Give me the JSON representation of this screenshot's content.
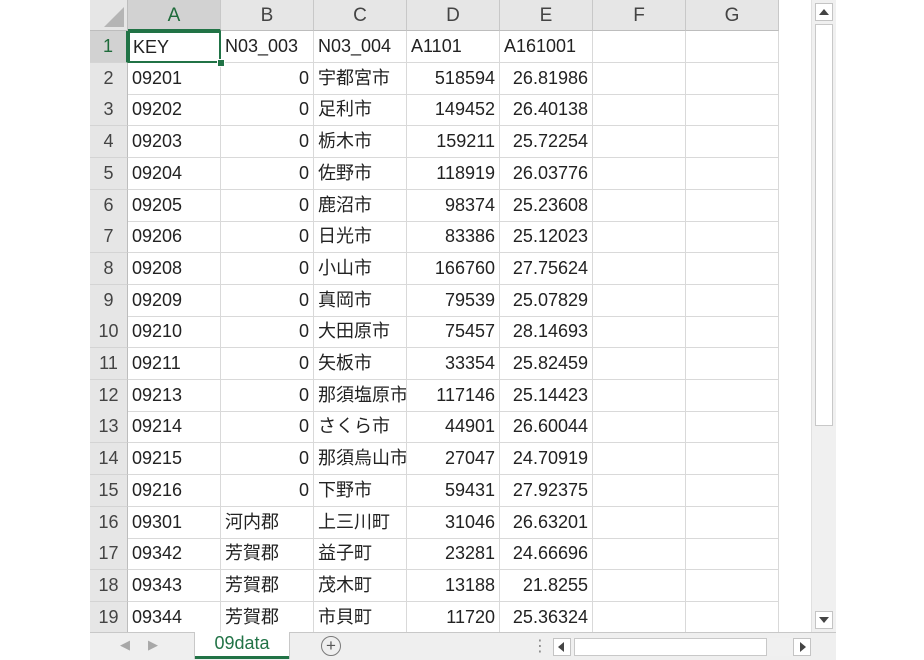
{
  "columns": [
    "A",
    "B",
    "C",
    "D",
    "E",
    "F",
    "G"
  ],
  "rows": [
    {
      "n": "1",
      "cells": [
        "KEY",
        "N03_003",
        "N03_004",
        "A1101",
        "A161001",
        "",
        ""
      ]
    },
    {
      "n": "2",
      "cells": [
        "09201",
        "0",
        "宇都宮市",
        "518594",
        "26.81986",
        "",
        ""
      ]
    },
    {
      "n": "3",
      "cells": [
        "09202",
        "0",
        "足利市",
        "149452",
        "26.40138",
        "",
        ""
      ]
    },
    {
      "n": "4",
      "cells": [
        "09203",
        "0",
        "栃木市",
        "159211",
        "25.72254",
        "",
        ""
      ]
    },
    {
      "n": "5",
      "cells": [
        "09204",
        "0",
        "佐野市",
        "118919",
        "26.03776",
        "",
        ""
      ]
    },
    {
      "n": "6",
      "cells": [
        "09205",
        "0",
        "鹿沼市",
        "98374",
        "25.23608",
        "",
        ""
      ]
    },
    {
      "n": "7",
      "cells": [
        "09206",
        "0",
        "日光市",
        "83386",
        "25.12023",
        "",
        ""
      ]
    },
    {
      "n": "8",
      "cells": [
        "09208",
        "0",
        "小山市",
        "166760",
        "27.75624",
        "",
        ""
      ]
    },
    {
      "n": "9",
      "cells": [
        "09209",
        "0",
        "真岡市",
        "79539",
        "25.07829",
        "",
        ""
      ]
    },
    {
      "n": "10",
      "cells": [
        "09210",
        "0",
        "大田原市",
        "75457",
        "28.14693",
        "",
        ""
      ]
    },
    {
      "n": "11",
      "cells": [
        "09211",
        "0",
        "矢板市",
        "33354",
        "25.82459",
        "",
        ""
      ]
    },
    {
      "n": "12",
      "cells": [
        "09213",
        "0",
        "那須塩原市",
        "117146",
        "25.14423",
        "",
        ""
      ]
    },
    {
      "n": "13",
      "cells": [
        "09214",
        "0",
        "さくら市",
        "44901",
        "26.60044",
        "",
        ""
      ]
    },
    {
      "n": "14",
      "cells": [
        "09215",
        "0",
        "那須烏山市",
        "27047",
        "24.70919",
        "",
        ""
      ]
    },
    {
      "n": "15",
      "cells": [
        "09216",
        "0",
        "下野市",
        "59431",
        "27.92375",
        "",
        ""
      ]
    },
    {
      "n": "16",
      "cells": [
        "09301",
        "河内郡",
        "上三川町",
        "31046",
        "26.63201",
        "",
        ""
      ]
    },
    {
      "n": "17",
      "cells": [
        "09342",
        "芳賀郡",
        "益子町",
        "23281",
        "24.66696",
        "",
        ""
      ]
    },
    {
      "n": "18",
      "cells": [
        "09343",
        "芳賀郡",
        "茂木町",
        "13188",
        "21.8255",
        "",
        ""
      ]
    },
    {
      "n": "19",
      "cells": [
        "09344",
        "芳賀郡",
        "市貝町",
        "11720",
        "25.36324",
        "",
        ""
      ]
    }
  ],
  "active_cell": "A1",
  "sheet_tab": {
    "label": "09data"
  },
  "accent_color": "#217346",
  "icons": {
    "add_sheet": "plus-circle-icon",
    "scroll_up": "triangle-up-icon",
    "scroll_down": "triangle-down-icon",
    "scroll_left": "triangle-left-icon",
    "scroll_right": "triangle-right-icon"
  }
}
